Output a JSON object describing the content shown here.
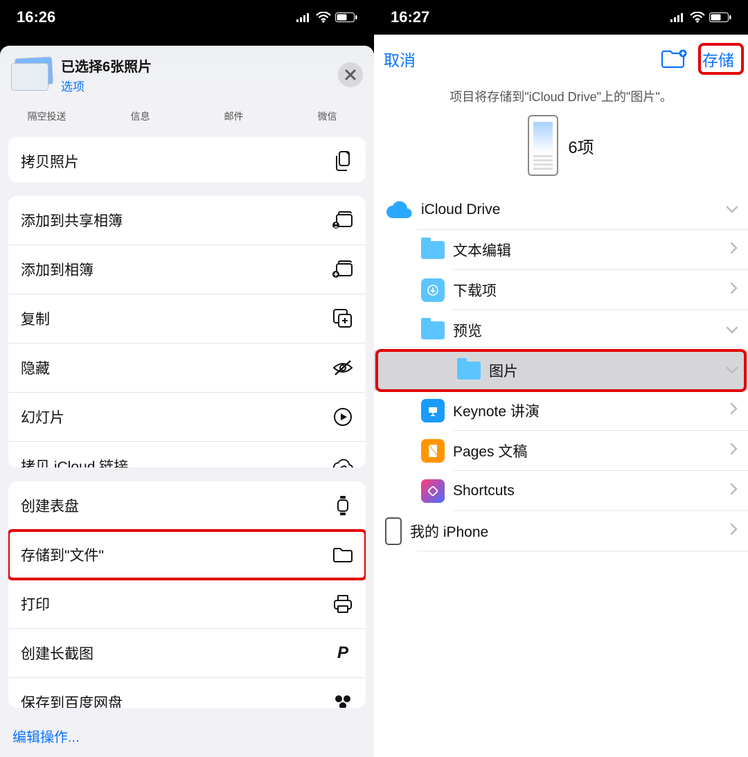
{
  "left": {
    "status_time": "16:26",
    "title": "已选择6张照片",
    "options_label": "选项",
    "share_targets": [
      "隔空投送",
      "信息",
      "邮件",
      "微信"
    ],
    "actions_group1": [
      {
        "label": "拷贝照片",
        "icon": "copy-docs-icon"
      }
    ],
    "actions_group2": [
      {
        "label": "添加到共享相簿",
        "icon": "shared-album-icon"
      },
      {
        "label": "添加到相簿",
        "icon": "add-album-icon"
      },
      {
        "label": "复制",
        "icon": "duplicate-icon"
      },
      {
        "label": "隐藏",
        "icon": "hide-icon"
      },
      {
        "label": "幻灯片",
        "icon": "play-icon"
      },
      {
        "label": "拷贝 iCloud 链接",
        "icon": "cloud-link-icon"
      }
    ],
    "actions_group3": [
      {
        "label": "创建表盘",
        "icon": "watch-icon"
      },
      {
        "label": "存储到\"文件\"",
        "icon": "folder-icon",
        "highlight": true
      },
      {
        "label": "打印",
        "icon": "print-icon"
      },
      {
        "label": "创建长截图",
        "icon": "p-icon"
      },
      {
        "label": "保存到百度网盘",
        "icon": "baidu-icon"
      }
    ],
    "edit_actions": "编辑操作..."
  },
  "right": {
    "status_time": "16:27",
    "cancel": "取消",
    "save": "存储",
    "save_desc": "项目将存储到\"iCloud Drive\"上的\"图片\"。",
    "count_label": "6项",
    "rows": [
      {
        "name": "iCloud Drive",
        "type": "icloud",
        "indent": 0,
        "chev": "down"
      },
      {
        "name": "文本编辑",
        "type": "folder",
        "indent": 1,
        "chev": "right"
      },
      {
        "name": "下载项",
        "type": "downloads",
        "indent": 1,
        "chev": "right"
      },
      {
        "name": "预览",
        "type": "folder",
        "indent": 1,
        "chev": "down"
      },
      {
        "name": "图片",
        "type": "folder",
        "indent": 2,
        "chev": "down",
        "selected": true,
        "highlight": true
      },
      {
        "name": "Keynote 讲演",
        "type": "keynote",
        "indent": 1,
        "chev": "right"
      },
      {
        "name": "Pages 文稿",
        "type": "pages",
        "indent": 1,
        "chev": "right"
      },
      {
        "name": "Shortcuts",
        "type": "shortcuts",
        "indent": 1,
        "chev": "right"
      },
      {
        "name": "我的 iPhone",
        "type": "iphone",
        "indent": 0,
        "chev": "right"
      }
    ]
  }
}
